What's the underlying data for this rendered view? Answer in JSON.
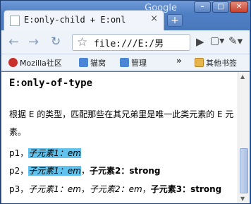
{
  "titlebar": {
    "brand": "Google"
  },
  "tab": {
    "title": "E:only-child + E:onl",
    "close": "×"
  },
  "toolbar": {
    "address_value": "file:///E:/男",
    "back": "←",
    "forward": "→",
    "reload": "↻"
  },
  "bookmarks": {
    "items": [
      {
        "label": "Mozilla社区"
      },
      {
        "label": "猫窝"
      },
      {
        "label": "管理"
      }
    ],
    "more": "»",
    "other": "其他书签"
  },
  "content": {
    "heading": "E:only-of-type",
    "description": "根据 E 的类型，匹配那些在其兄弟里是唯一此类元素的 E 元素。",
    "lines": [
      {
        "prefix": "p1，",
        "parts": [
          {
            "text": "子元素1：em",
            "style": "em-hl"
          }
        ]
      },
      {
        "prefix": "p2，",
        "parts": [
          {
            "text": "子元素1：em",
            "style": "em-hl"
          },
          {
            "text": "，",
            "style": "plain"
          },
          {
            "text": "子元素2：strong",
            "style": "strong"
          }
        ]
      },
      {
        "prefix": "p3，",
        "parts": [
          {
            "text": "子元素1：em",
            "style": "em"
          },
          {
            "text": "，",
            "style": "plain"
          },
          {
            "text": "子元素2：em",
            "style": "em"
          },
          {
            "text": "，",
            "style": "plain"
          },
          {
            "text": "子元素3：strong",
            "style": "strong"
          }
        ]
      }
    ]
  },
  "colors": {
    "highlight": "#61c3ed",
    "frame": "#4f7fc4"
  }
}
